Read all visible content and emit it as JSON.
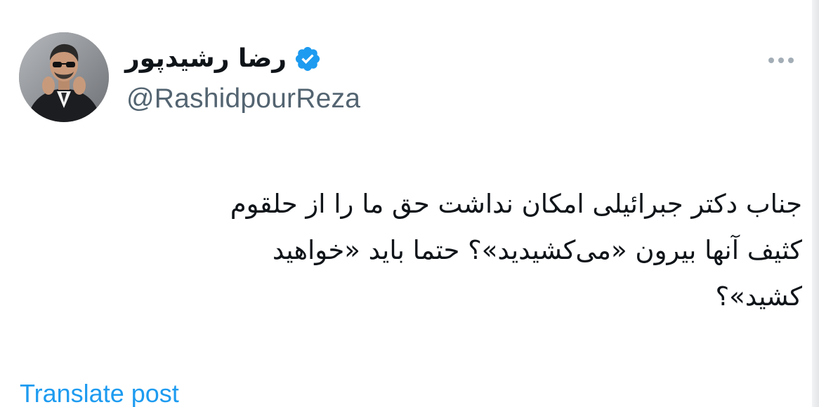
{
  "author": {
    "display_name": "رضا رشیدپور",
    "handle": "@RashidpourReza",
    "verified": true,
    "avatar_icon": "avatar-photo",
    "badge_icon": "verified-badge-icon",
    "badge_color": "#1d9bf0"
  },
  "post": {
    "lines": [
      "جناب دکتر جبرائیلی امکان نداشت حق ما را از حلقوم",
      "کثیف آنها بیرون «می‌کشیدید»؟ حتما باید «خواهید",
      "کشید»؟"
    ]
  },
  "actions": {
    "more_icon": "more-options-icon",
    "translate_label": "Translate post",
    "link_color": "#1d9bf0"
  }
}
